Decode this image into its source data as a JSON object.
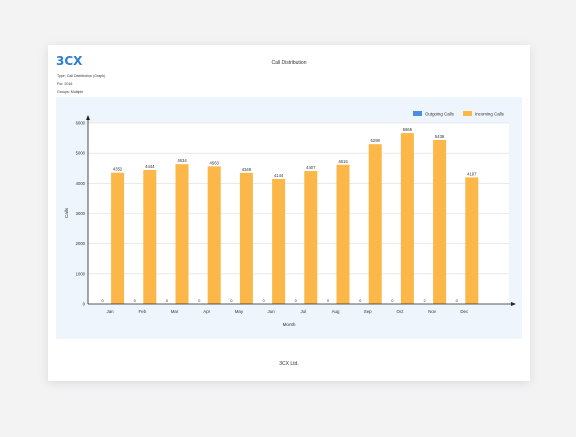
{
  "header": {
    "logo": "3CX",
    "title": "Call Distribution",
    "type_line": "Type: Call Distribution (Graph)",
    "for_line": "For: 2016",
    "groups_line": "Groups: Multiple"
  },
  "footer": {
    "text": "3CX Ltd."
  },
  "colors": {
    "outgoing": "#4a90e2",
    "incoming": "#fbb748",
    "panel": "#eef5fc",
    "logo": "#2f7ecf"
  },
  "chart_data": {
    "type": "bar",
    "categories": [
      "Jan",
      "Feb",
      "Mar",
      "Apr",
      "May",
      "Jun",
      "Jul",
      "Aug",
      "Sep",
      "Oct",
      "Nov",
      "Dec"
    ],
    "series": [
      {
        "name": "Outgoing Calls",
        "values": [
          0,
          0,
          0,
          0,
          0,
          0,
          0,
          0,
          0,
          0,
          2,
          0
        ]
      },
      {
        "name": "Incoming Calls",
        "values": [
          4352,
          4444,
          4634,
          4563,
          4348,
          4144,
          4407,
          4616,
          5298,
          5665,
          5436,
          4197
        ]
      }
    ],
    "xlabel": "Month",
    "ylabel": "Calls",
    "ylim": [
      0,
      6000
    ],
    "yticks": [
      0,
      1000,
      2000,
      3000,
      4000,
      5000,
      6000
    ],
    "grid": true,
    "legend_position": "top-right"
  }
}
